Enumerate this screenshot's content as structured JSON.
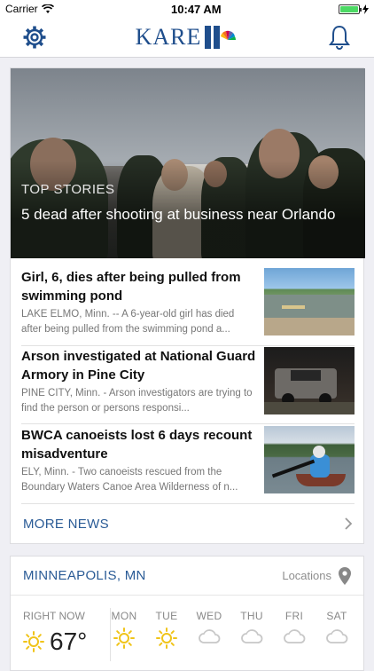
{
  "status_bar": {
    "carrier": "Carrier",
    "time": "10:47 AM",
    "battery_level": 1.0
  },
  "header": {
    "logo_text": "KARE",
    "logo_number": "11",
    "icons": [
      "gear-icon",
      "bell-icon"
    ]
  },
  "hero": {
    "kicker": "TOP STORIES",
    "title": "5 dead after shooting at business near Orlando"
  },
  "stories": [
    {
      "title": "Girl, 6, dies after being pulled from swimming pond",
      "summary": "LAKE ELMO, Minn. -- A 6-year-old girl has died after being pulled from the swimming pond a..."
    },
    {
      "title": "Arson investigated at National Guard Armory in Pine City",
      "summary": "PINE CITY, Minn. - Arson investigators are trying to find the person or persons responsi..."
    },
    {
      "title": "BWCA canoeists lost 6 days recount misadventure",
      "summary": "ELY, Minn. - Two canoeists rescued from the Boundary Waters Canoe Area Wilderness of n..."
    }
  ],
  "more_news": {
    "label": "MORE NEWS"
  },
  "weather": {
    "city": "MINNEAPOLIS, MN",
    "locations_label": "Locations",
    "now": {
      "label": "RIGHT NOW",
      "temp": "67°",
      "icon": "sun-icon"
    },
    "days": [
      {
        "label": "MON",
        "icon": "sun-icon"
      },
      {
        "label": "TUE",
        "icon": "sun-icon"
      },
      {
        "label": "WED",
        "icon": "cloud-icon"
      },
      {
        "label": "THU",
        "icon": "cloud-icon"
      },
      {
        "label": "FRI",
        "icon": "cloud-icon"
      },
      {
        "label": "SAT",
        "icon": "cloud-icon"
      }
    ]
  },
  "colors": {
    "accent": "#2a5b96",
    "sun": "#f0c419",
    "cloud": "#c8c8c8",
    "battery": "#4cd964"
  }
}
